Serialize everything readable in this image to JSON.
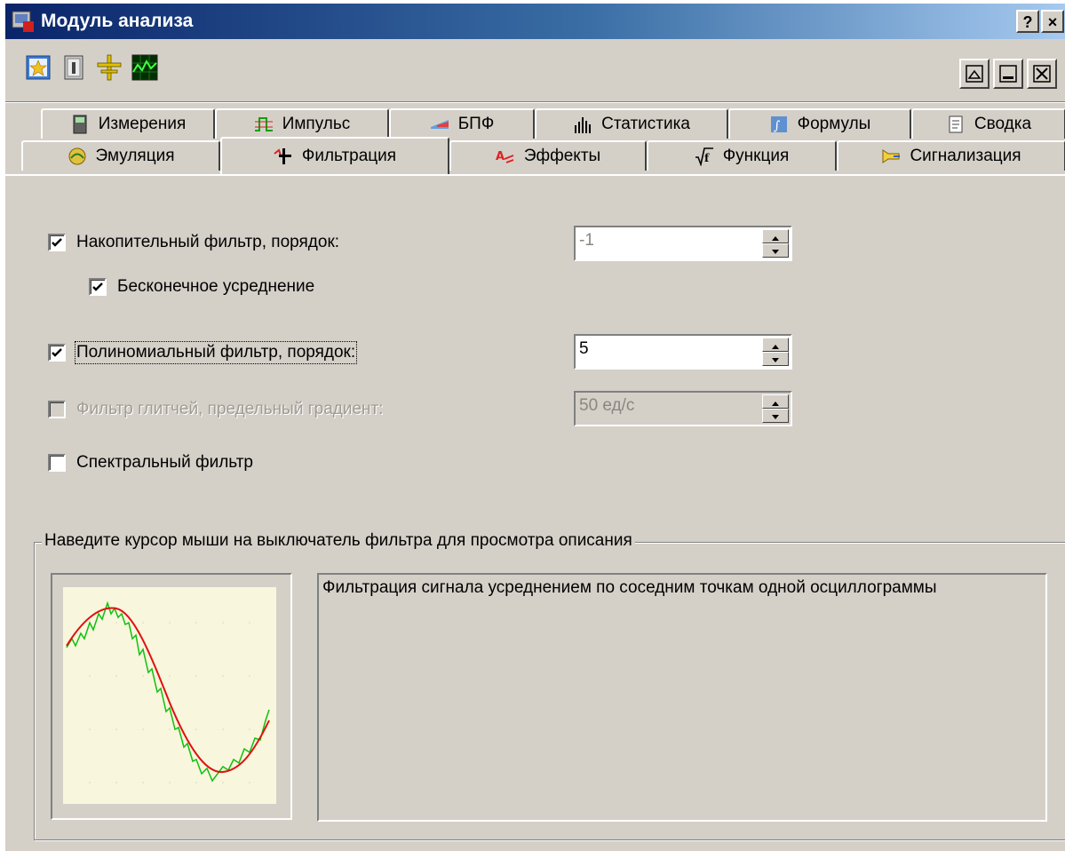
{
  "window": {
    "title": "Модуль анализа",
    "help_button": "?",
    "close_button": "×"
  },
  "toolbar": {
    "icons": [
      "star-icon",
      "info-icon",
      "cursor-icon",
      "oscilloscope-icon"
    ],
    "window_buttons": [
      "pin-icon",
      "minimize-icon",
      "close-icon"
    ]
  },
  "tabs": {
    "row1": [
      {
        "label": "Измерения",
        "icon": "meter-icon"
      },
      {
        "label": "Импульс",
        "icon": "pulse-icon"
      },
      {
        "label": "БПФ",
        "icon": "fft-icon"
      },
      {
        "label": "Статистика",
        "icon": "bars-icon"
      },
      {
        "label": "Формулы",
        "icon": "formula-icon"
      },
      {
        "label": "Сводка",
        "icon": "document-icon"
      }
    ],
    "row2": [
      {
        "label": "Эмуляция",
        "icon": "emulation-icon"
      },
      {
        "label": "Фильтрация",
        "icon": "filter-icon",
        "active": true
      },
      {
        "label": "Эффекты",
        "icon": "effects-icon"
      },
      {
        "label": "Функция",
        "icon": "function-icon"
      },
      {
        "label": "Сигнализация",
        "icon": "horn-icon"
      }
    ]
  },
  "filters": {
    "accumulative": {
      "label": "Накопительный фильтр, порядок:",
      "checked": true,
      "value": "-1"
    },
    "infinite_avg": {
      "label": "Бесконечное усреднение",
      "checked": true
    },
    "polynomial": {
      "label": "Полиномиальный фильтр, порядок:",
      "checked": true,
      "value": "5"
    },
    "glitch": {
      "label": "Фильтр глитчей, предельный градиент:",
      "checked": false,
      "disabled": true,
      "value": "50 ед/с"
    },
    "spectral": {
      "label": "Спектральный фильтр",
      "checked": false
    }
  },
  "description": {
    "group_title": "Наведите курсор мыши на выключатель фильтра для просмотра описания",
    "text": "Фильтрация сигнала усреднением по соседним точкам одной осциллограммы"
  },
  "colors": {
    "raw_signal": "#10c010",
    "filtered_signal": "#e01010",
    "preview_bg": "#f8f6dc"
  }
}
